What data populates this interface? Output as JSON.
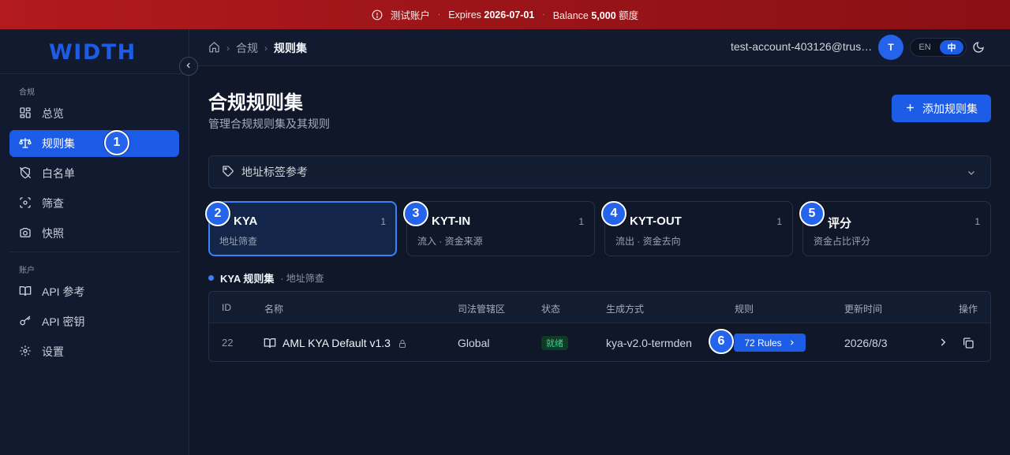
{
  "banner": {
    "account": "测试账户",
    "expires_label": "Expires",
    "expires_date": "2026-07-01",
    "balance_label": "Balance",
    "balance_value": "5,000",
    "balance_unit": "额度"
  },
  "sidebar": {
    "logo": "WIDTH",
    "section_compliance": "合规",
    "section_account": "账户",
    "items": [
      {
        "label": "总览",
        "icon": "dashboard-icon"
      },
      {
        "label": "规则集",
        "icon": "scale-icon",
        "active": true
      },
      {
        "label": "白名单",
        "icon": "shield-off-icon"
      },
      {
        "label": "筛查",
        "icon": "scan-icon"
      },
      {
        "label": "快照",
        "icon": "camera-icon"
      },
      {
        "label": "API 参考",
        "icon": "book-icon"
      },
      {
        "label": "API 密钥",
        "icon": "key-icon"
      },
      {
        "label": "设置",
        "icon": "gear-icon"
      }
    ]
  },
  "topbar": {
    "breadcrumb": [
      "合规",
      "规则集"
    ],
    "account_email": "test-account-403126@trustin.info",
    "avatar_initial": "T",
    "lang_en": "EN",
    "lang_zh": "中"
  },
  "page": {
    "title": "合规规则集",
    "subtitle": "管理合规规则集及其规则",
    "add_button": "添加规则集",
    "accordion_label": "地址标签参考"
  },
  "cards": [
    {
      "name": "KYA",
      "desc": "地址筛查",
      "count": "1",
      "marker": "2"
    },
    {
      "name": "KYT-IN",
      "desc": "流入 · 资金来源",
      "count": "1",
      "marker": "3"
    },
    {
      "name": "KYT-OUT",
      "desc": "流出 · 资金去向",
      "count": "1",
      "marker": "4"
    },
    {
      "name": "评分",
      "desc": "资金占比评分",
      "count": "1",
      "marker": "5"
    }
  ],
  "ruleset_header": {
    "title": "KYA 规则集",
    "subtitle": "· 地址筛查"
  },
  "table": {
    "columns": [
      "ID",
      "名称",
      "司法管辖区",
      "状态",
      "生成方式",
      "规则",
      "更新时间",
      "操作"
    ],
    "rows": [
      {
        "id": "22",
        "name": "AML KYA Default v1.3",
        "jurisdiction": "Global",
        "status": "就绪",
        "generation": "kya-v2.0-termden",
        "rules": "72 Rules",
        "updated": "2026/8/3"
      }
    ]
  },
  "markers": {
    "m1": "1",
    "m6": "6"
  },
  "colors": {
    "accent": "#1d5ce6",
    "banner": "#9a1418",
    "background": "#0f1729",
    "success": "#34d399"
  }
}
